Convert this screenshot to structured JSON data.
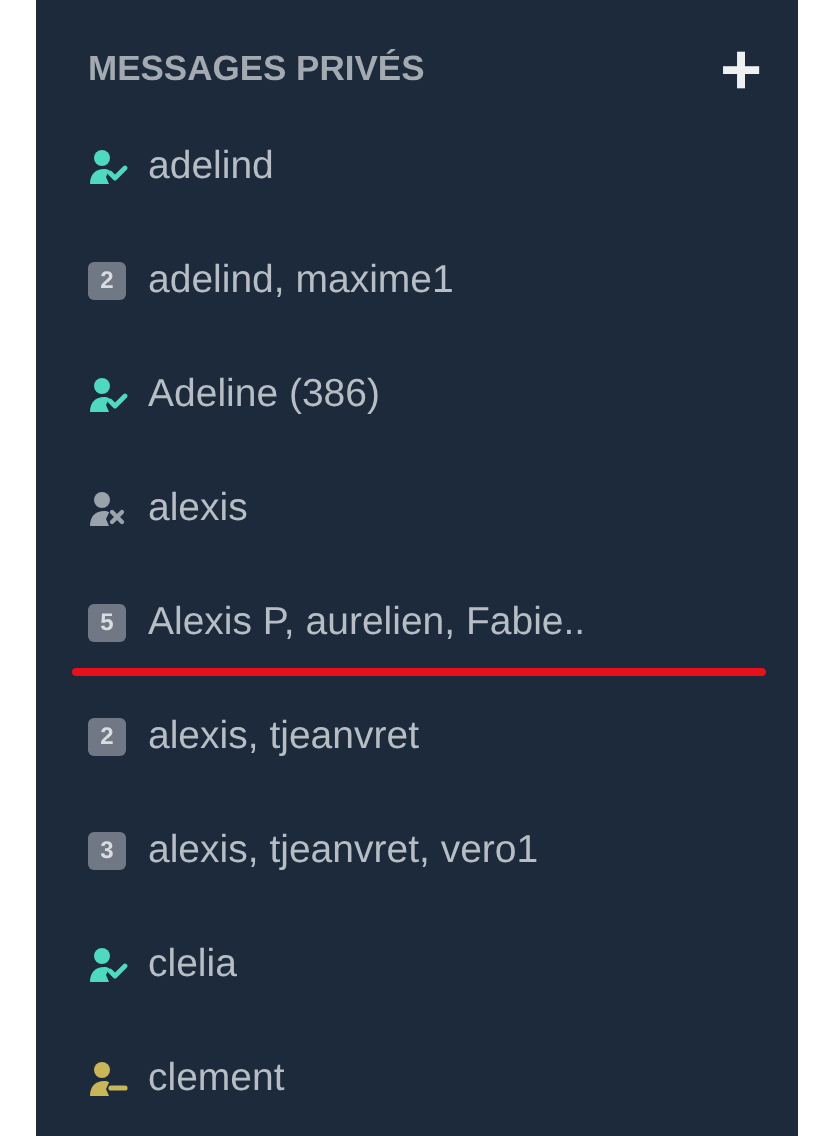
{
  "sidebar": {
    "heading": "MESSAGES PRIVÉS",
    "add_button": "+",
    "items": [
      {
        "kind": "online",
        "label": "adelind",
        "color": "#4fd8c2",
        "underlined": false
      },
      {
        "kind": "group",
        "label": "adelind, maxime1",
        "count": "2",
        "underlined": false
      },
      {
        "kind": "online",
        "label": "Adeline (386)",
        "color": "#4fd8c2",
        "underlined": false
      },
      {
        "kind": "offline",
        "label": "alexis",
        "color": "#9aa2ab",
        "underlined": false
      },
      {
        "kind": "group",
        "label": "Alexis P, aurelien, Fabie..",
        "count": "5",
        "underlined": true
      },
      {
        "kind": "group",
        "label": "alexis, tjeanvret",
        "count": "2",
        "underlined": false
      },
      {
        "kind": "group",
        "label": "alexis, tjeanvret, vero1",
        "count": "3",
        "underlined": false
      },
      {
        "kind": "online",
        "label": "clelia",
        "color": "#4fd8c2",
        "underlined": false
      },
      {
        "kind": "away",
        "label": "clement",
        "color": "#c9b658",
        "underlined": false
      }
    ]
  }
}
